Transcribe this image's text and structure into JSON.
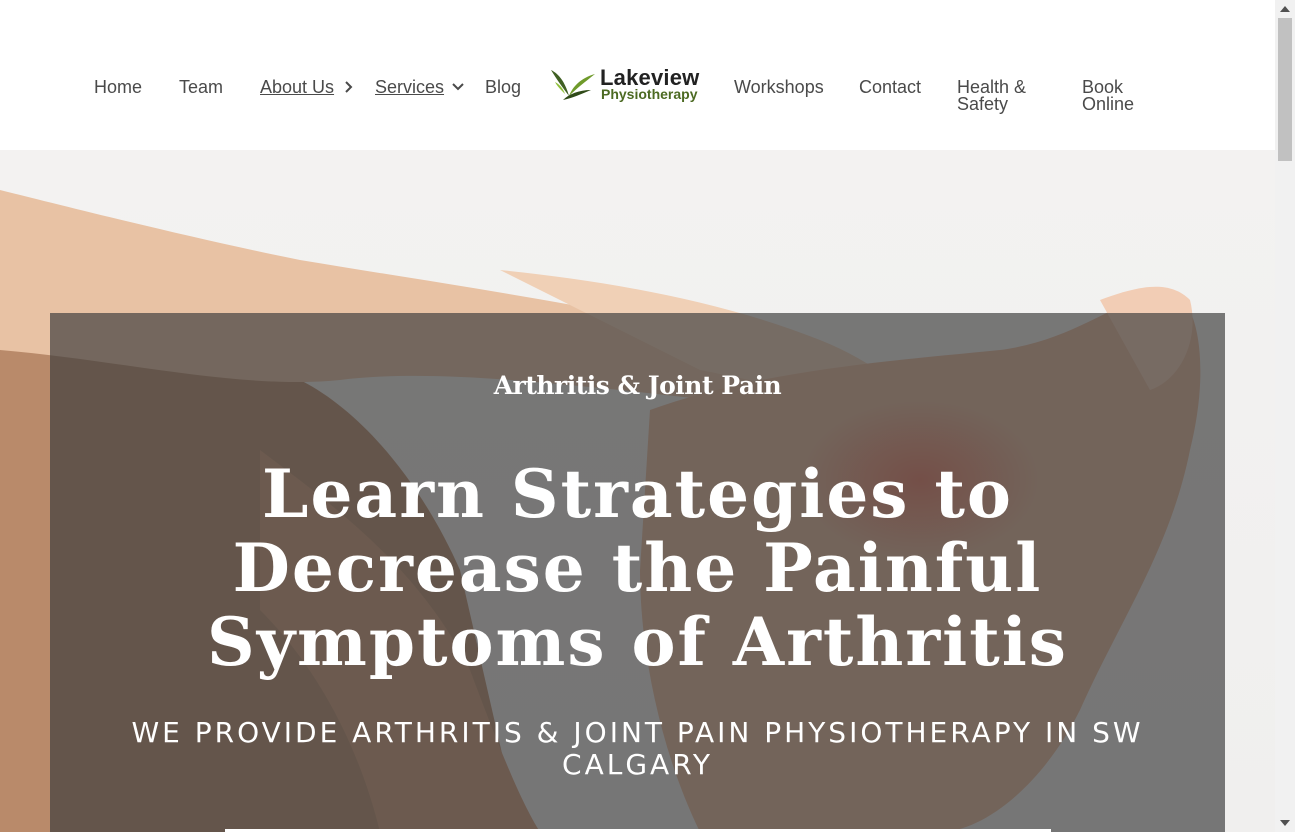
{
  "nav": {
    "home": "Home",
    "team": "Team",
    "about": "About Us",
    "services": "Services",
    "blog": "Blog",
    "workshops": "Workshops",
    "contact": "Contact",
    "health_safety": "Health & Safety",
    "book_online": "Book Online"
  },
  "logo": {
    "name": "Lakeview",
    "tagline": "Physiotherapy",
    "icon": "leaf-logo-icon"
  },
  "hero": {
    "kicker": "Arthritis & Joint Pain",
    "headline_line1": "Learn Strategies to",
    "headline_line2": "Decrease the Painful",
    "headline_line3": "Symptoms of Arthritis",
    "subhead": "WE PROVIDE ARTHRITIS & JOINT PAIN PHYSIOTHERAPY IN SW CALGARY"
  },
  "colors": {
    "nav_text": "#4a4a4a",
    "logo_green": "#4c6a22",
    "overlay": "#3c3c3c"
  }
}
